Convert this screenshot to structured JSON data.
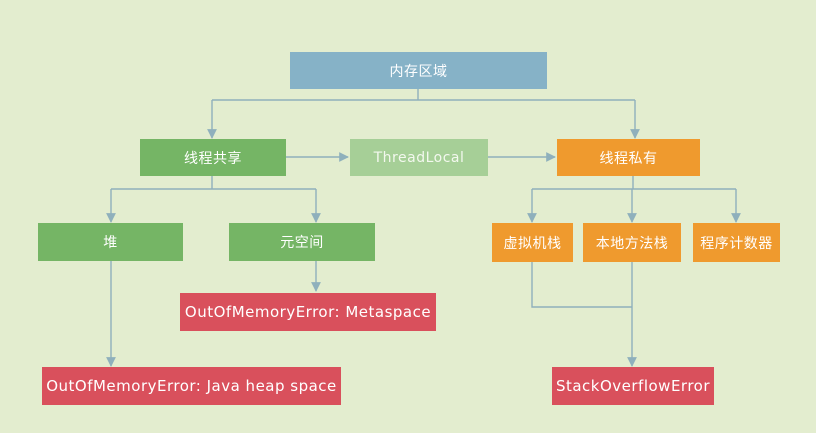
{
  "diagram": {
    "root": "内存区域",
    "shared": "线程共享",
    "thread_local": "ThreadLocal",
    "private": "线程私有",
    "heap": "堆",
    "metaspace": "元空间",
    "vm_stack": "虚拟机栈",
    "native_stack": "本地方法栈",
    "pc_register": "程序计数器",
    "err_metaspace": "OutOfMemoryError: Metaspace",
    "err_heap": "OutOfMemoryError: Java heap space",
    "err_stack": "StackOverflowError"
  },
  "colors": {
    "background": "#e3edcf",
    "root": "#86b2c7",
    "shared": "#75b565",
    "thread_local": "#a6cf97",
    "private": "#ef9a2e",
    "error": "#d9505c",
    "connector": "#8fb0bc"
  }
}
